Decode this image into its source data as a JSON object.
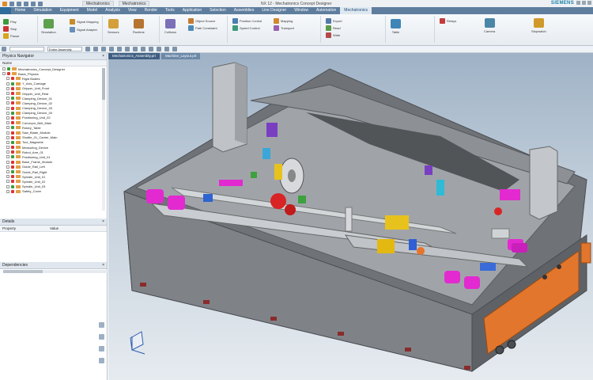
{
  "app": {
    "window_title": "NX 12 - Mechatronics Concept Designer",
    "brand": "SIEMENS",
    "doc_tabs": [
      "Mechatronics",
      "Mechatronics"
    ]
  },
  "ribbon": {
    "tabs": [
      "Home",
      "Simulation",
      "Equipment",
      "Model",
      "Analysis",
      "View",
      "Render",
      "Tools",
      "Application",
      "Selection",
      "Assemblies",
      "Line Designer",
      "Window",
      "Automation",
      "Mechatronics"
    ],
    "active_tab": "Mechatronics",
    "buttons": [
      "Play",
      "Stop",
      "Pause",
      "Simulation",
      "Signal Mapping",
      "Signal Adapter",
      "Sensors",
      "Runtime",
      "Collision",
      "Object Source",
      "Path Constraint",
      "Position Control",
      "Speed Control",
      "Mapping",
      "Transport",
      "Export",
      "Read",
      "Write",
      "Table",
      "Relays",
      "Camera",
      "Stopwatch"
    ]
  },
  "toolbar2": {
    "filter_placeholder": "Entire Assembly"
  },
  "left_panel": {
    "title": "Physics Navigator",
    "column_name": "Name",
    "tree_items": [
      "Mechatronics_Concept_Designer",
      "Basic_Physics",
      "Rigid Bodies",
      "Y_Axis_Carriage",
      "Gripper_Unit_Front",
      "Gripper_Unit_Rear",
      "Clamping_Device_01",
      "Clamping_Device_02",
      "Clamping_Device_03",
      "Clamping_Device_04",
      "Positioning_Unit_02",
      "Conveyor_Belt_Main",
      "Rotary_Table",
      "Saw_Blade_Module",
      "Shuttle_01_Carrier_Main",
      "Tool_Magazine",
      "Measuring_Device",
      "Robot_Arm_01",
      "Positioning_Unit_01",
      "Base_Frame_Module",
      "Guide_Rail_Left",
      "Guide_Rail_Right",
      "Spindle_Unit_01",
      "Spindle_Unit_02",
      "Spindle_Unit_03",
      "Safety_Cover"
    ],
    "details_title": "Details",
    "details_cols": [
      "Property",
      "Value"
    ],
    "dependencies_title": "Dependencies"
  },
  "viewport": {
    "tabs": [
      "Mechatronics_Assembly.prt",
      "Machine_Layout.prt"
    ]
  },
  "colors": {
    "ribbon_blue": "#5f7e9e",
    "machine_gray": "#8e9299",
    "accent_orange": "#e2762c",
    "accent_magenta": "#e22ad0"
  }
}
